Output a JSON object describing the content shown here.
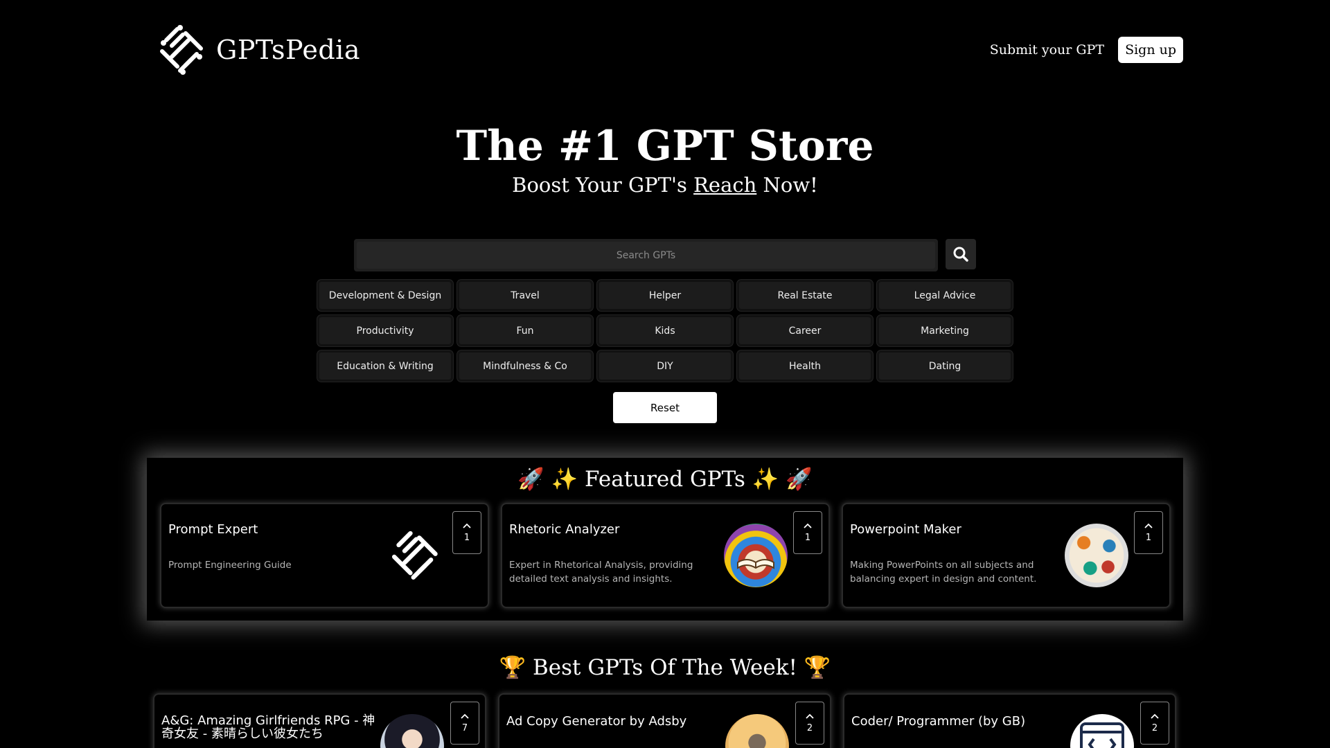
{
  "header": {
    "logo_text": "GPTsPedia",
    "submit_link": "Submit your GPT",
    "signup_label": "Sign up"
  },
  "hero": {
    "title": "The #1 GPT Store",
    "subtitle_before": "Boost Your GPT's ",
    "subtitle_link": "Reach",
    "subtitle_after": " Now!"
  },
  "search": {
    "placeholder": "Search GPTs",
    "value": ""
  },
  "categories": [
    "Development & Design",
    "Travel",
    "Helper",
    "Real Estate",
    "Legal Advice",
    "Productivity",
    "Fun",
    "Kids",
    "Career",
    "Marketing",
    "Education & Writing",
    "Mindfulness & Co",
    "DIY",
    "Health",
    "Dating"
  ],
  "reset_label": "Reset",
  "featured": {
    "title": "🚀 ✨ Featured GPTs ✨ 🚀",
    "cards": [
      {
        "title": "Prompt Expert",
        "description": "Prompt Engineering Guide",
        "votes": "1",
        "image": "logo-icon"
      },
      {
        "title": "Rhetoric Analyzer",
        "description": "Expert in Rhetorical Analysis, providing detailed text analysis and insights.",
        "votes": "1",
        "image": "book-icon"
      },
      {
        "title": "Powerpoint Maker",
        "description": "Making PowerPoints on all subjects and balancing expert in design and content.",
        "votes": "1",
        "image": "colorful-objects-icon"
      }
    ]
  },
  "best": {
    "title": "🏆 Best GPTs Of The Week! 🏆",
    "cards": [
      {
        "title": "A&G: Amazing Girlfriends RPG - 神奇女友 - 素晴らしい彼女たち",
        "votes": "7",
        "image": "anime-avatar"
      },
      {
        "title": "Ad Copy Generator by Adsby",
        "votes": "2",
        "image": "microphone-icon"
      },
      {
        "title": "Coder/ Programmer (by GB)",
        "votes": "2",
        "image": "code-window-icon"
      }
    ]
  },
  "colors": {
    "background": "#000000",
    "accent": "#ffffff",
    "card_border": "#2a2a2a"
  }
}
